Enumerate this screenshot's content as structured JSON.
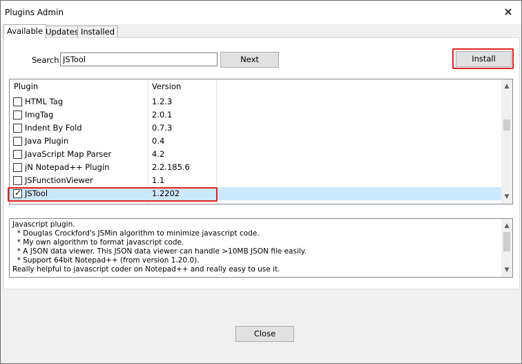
{
  "window": {
    "title": "Plugins Admin",
    "close_glyph": "✕"
  },
  "tabs": [
    {
      "label": "Available",
      "active": true
    },
    {
      "label": "Updates",
      "active": false
    },
    {
      "label": "Installed",
      "active": false
    }
  ],
  "search": {
    "label": "Search:",
    "value": "JSTool"
  },
  "buttons": {
    "next": "Next",
    "install": "Install",
    "close": "Close"
  },
  "table": {
    "columns": [
      "Plugin",
      "Version"
    ],
    "rows": [
      {
        "name": "HTML Tag",
        "version": "1.2.3",
        "checked": false
      },
      {
        "name": "ImgTag",
        "version": "2.0.1",
        "checked": false
      },
      {
        "name": "Indent By Fold",
        "version": "0.7.3",
        "checked": false
      },
      {
        "name": "Java Plugin",
        "version": "0.4",
        "checked": false
      },
      {
        "name": "JavaScript Map Parser",
        "version": "4.2",
        "checked": false
      },
      {
        "name": "jN Notepad++ Plugin",
        "version": "2.2.185.6",
        "checked": false
      },
      {
        "name": "JSFunctionViewer",
        "version": "1.1",
        "checked": false
      },
      {
        "name": "JSTool",
        "version": "1.2202",
        "checked": true
      }
    ]
  },
  "description": [
    "Javascript plugin.",
    "  * Douglas Crockford's JSMin algorithm to minimize javascript code.",
    "  * My own algorithm to format javascript code.",
    "  * A JSON data viewer. This JSON data viewer can handle >10MB JSON file easily.",
    "  * Support 64bit Notepad++ (from version 1.20.0).",
    "Really helpful to javascript coder on Notepad++ and really easy to use it."
  ],
  "icons": {
    "checkbox_checked": "checkmark-icon",
    "scroll_up": "chevron-up-icon",
    "scroll_down": "chevron-down-icon"
  },
  "colors": {
    "highlight": "#e02020",
    "selected_row": "#cce8ff"
  }
}
